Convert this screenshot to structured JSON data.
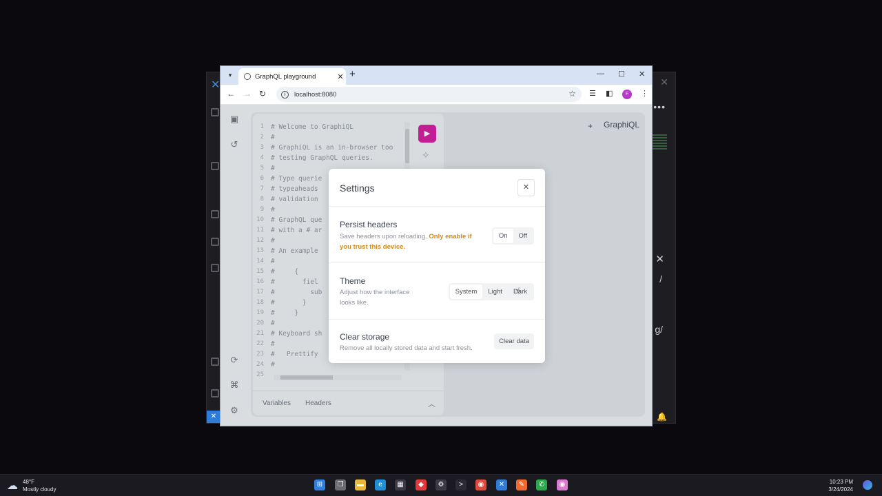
{
  "browser": {
    "tab_title": "GraphQL playground",
    "url": "localhost:8080",
    "profile_initial": "F"
  },
  "graphiql": {
    "header_title": "GraphiQL",
    "code_lines": [
      {
        "n": "1",
        "t": "# Welcome to GraphiQL"
      },
      {
        "n": "2",
        "t": "#"
      },
      {
        "n": "3",
        "t": "# GraphiQL is an in-browser too"
      },
      {
        "n": "4",
        "t": "# testing GraphQL queries."
      },
      {
        "n": "5",
        "t": "#"
      },
      {
        "n": "6",
        "t": "# Type querie"
      },
      {
        "n": "7",
        "t": "# typeaheads"
      },
      {
        "n": "8",
        "t": "# validation"
      },
      {
        "n": "9",
        "t": "#"
      },
      {
        "n": "10",
        "t": "# GraphQL que"
      },
      {
        "n": "11",
        "t": "# with a # ar"
      },
      {
        "n": "12",
        "t": "#"
      },
      {
        "n": "13",
        "t": "# An example"
      },
      {
        "n": "14",
        "t": "#"
      },
      {
        "n": "15",
        "t": "#     {"
      },
      {
        "n": "16",
        "t": "#       fiel"
      },
      {
        "n": "17",
        "t": "#         sub"
      },
      {
        "n": "18",
        "t": "#       }"
      },
      {
        "n": "19",
        "t": "#     }"
      },
      {
        "n": "20",
        "t": "#"
      },
      {
        "n": "21",
        "t": "# Keyboard sh"
      },
      {
        "n": "22",
        "t": "#"
      },
      {
        "n": "23",
        "t": "#   Prettify"
      },
      {
        "n": "24",
        "t": "#"
      },
      {
        "n": "25",
        "t": ""
      }
    ],
    "bottom_tabs": {
      "variables": "Variables",
      "headers": "Headers"
    }
  },
  "settings": {
    "title": "Settings",
    "persist": {
      "title": "Persist headers",
      "desc": "Save headers upon reloading.",
      "warning_line1": "Only enable if",
      "warning_line2": "you trust this device.",
      "on": "On",
      "off": "Off"
    },
    "theme": {
      "title": "Theme",
      "desc_line1": "Adjust how the interface",
      "desc_line2": "looks like.",
      "system": "System",
      "light": "Light",
      "dark": "Dark"
    },
    "storage": {
      "title": "Clear storage",
      "desc": "Remove all locally stored data and start fresh.",
      "button": "Clear data"
    }
  },
  "taskbar": {
    "temperature": "48°F",
    "weather": "Mostly cloudy",
    "time": "10:23 PM",
    "date": "3/24/2024"
  }
}
